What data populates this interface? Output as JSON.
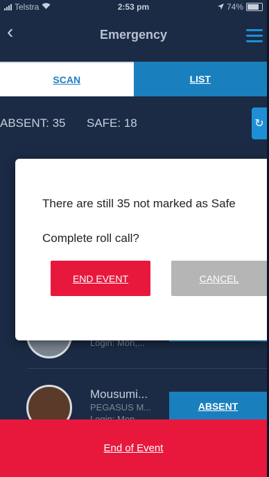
{
  "status_bar": {
    "carrier": "Telstra",
    "time": "2:53 pm",
    "battery": "74%"
  },
  "nav": {
    "title": "Emergency"
  },
  "tabs": [
    {
      "label": "SCAN",
      "active": true
    },
    {
      "label": "LIST",
      "active": false
    }
  ],
  "counts": {
    "absent": "ABSENT: 35",
    "safe": "SAFE: 18"
  },
  "list": [
    {
      "name": "",
      "org": "",
      "login": "Login: Mon,...",
      "action": ""
    },
    {
      "name": "Mousumi...",
      "org": "PEGASUS M...",
      "login": "Login: Mon,...",
      "action": "ABSENT"
    }
  ],
  "dialog": {
    "message": "There are still 35 not marked as Safe",
    "question": "Complete roll call?",
    "end_label": "END EVENT",
    "cancel_label": "CANCEL"
  },
  "footer": {
    "label": "End of Event"
  },
  "colors": {
    "brand_blue": "#1a7fbd",
    "alert_red": "#e8183d",
    "dark_bg": "#1b2b45"
  }
}
